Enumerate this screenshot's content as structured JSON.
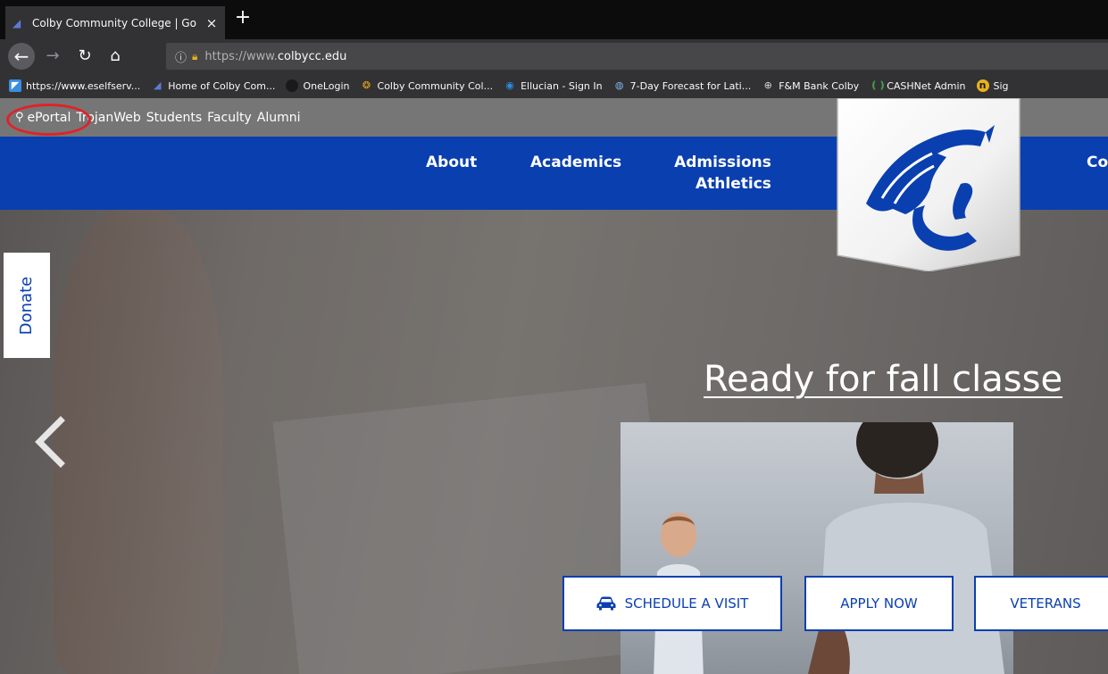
{
  "browser": {
    "tab": {
      "title": "Colby Community College | Go",
      "close": "×"
    },
    "new_tab": "+",
    "url": {
      "prefix": "https://www.",
      "domain": "colbycc.edu"
    },
    "bookmarks": [
      {
        "label": "https://www.eselfserv...",
        "icon": "eselfserv-icon",
        "color": "#3a8de0"
      },
      {
        "label": "Home of Colby Com...",
        "icon": "colby-trojan-icon",
        "color": "#5b7bd6"
      },
      {
        "label": "OneLogin",
        "icon": "onelogin-icon",
        "color": "#1a1a1a"
      },
      {
        "label": "Colby Community Col...",
        "icon": "lifebuoy-icon",
        "color": "#e8a31b"
      },
      {
        "label": "Ellucian - Sign In",
        "icon": "ellucian-icon",
        "color": "#2a8de0"
      },
      {
        "label": "7-Day Forecast for Lati...",
        "icon": "weather-icon",
        "color": "#3a7fd9"
      },
      {
        "label": "F&M Bank Colby",
        "icon": "globe-icon",
        "color": "#d7d7db"
      },
      {
        "label": "CASHNet Admin",
        "icon": "cashnet-icon",
        "color": "#3fa34d"
      },
      {
        "label": "Sig",
        "icon": "signin-icon",
        "color": "#e8b21b"
      }
    ]
  },
  "site": {
    "utility_links": [
      "ePortal",
      "TrojanWeb",
      "Students",
      "Faculty",
      "Alumni"
    ],
    "nav": {
      "about": "About",
      "academics": "Academics",
      "admissions": "Admissions",
      "athletics": "Athletics",
      "cut_off": "Co"
    },
    "donate": "Donate",
    "headline": "Ready for fall classe",
    "cta": {
      "visit": "SCHEDULE A VISIT",
      "apply": "APPLY NOW",
      "veterans": "VETERANS"
    },
    "colors": {
      "brand_blue": "#0a3fb0",
      "highlight_red": "#e0222a"
    }
  }
}
